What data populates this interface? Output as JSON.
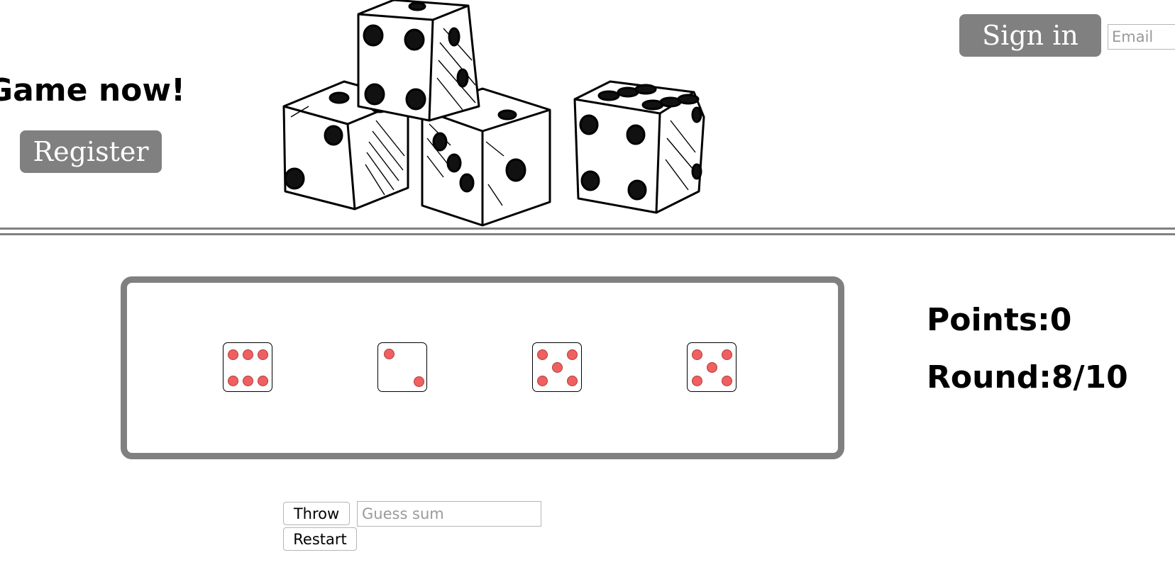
{
  "header": {
    "promo_heading": "Game now!",
    "register_label": "Register",
    "signin_label": "Sign in",
    "email_placeholder": "Email",
    "illustration_icon": "dice-illustration"
  },
  "game": {
    "dice": [
      {
        "value": 6,
        "icon": "die-six-icon"
      },
      {
        "value": 2,
        "icon": "die-two-icon"
      },
      {
        "value": 5,
        "icon": "die-five-icon"
      },
      {
        "value": 5,
        "icon": "die-five-icon"
      }
    ],
    "pip_color": "#f06060",
    "board_border_color": "#808080",
    "points_label": "Points:0",
    "round_label": "Round:8/10"
  },
  "controls": {
    "throw_label": "Throw",
    "guess_placeholder": "Guess sum",
    "restart_label": "Restart"
  },
  "colors": {
    "button_gray": "#808080",
    "divider": "#808080"
  }
}
